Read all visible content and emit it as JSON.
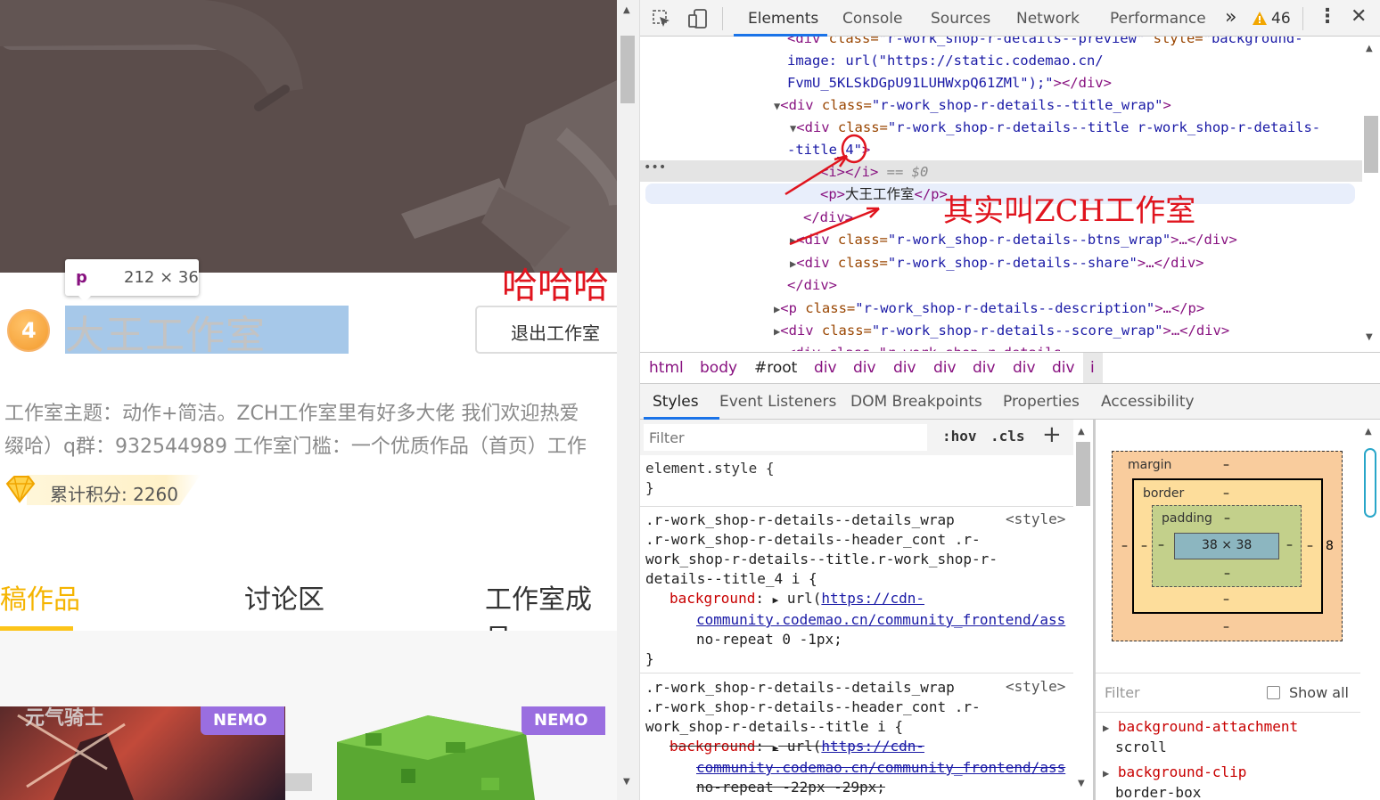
{
  "left": {
    "tooltip": {
      "tag": "p",
      "size": "212 × 36"
    },
    "level": "4",
    "studio_name": "大王工作室",
    "exit_button": "退出工作室",
    "red_annotation": "哈哈哈",
    "description_line1": "工作室主题：动作+简洁。ZCH工作室里有好多大佬 我们欢迎热爱",
    "description_line2": "缀哈）q群：932544989 工作室门槛：一个优质作品（首页）工作",
    "points": "累计积分: 2260",
    "tabs": [
      {
        "label": "投稿作品",
        "active": true
      },
      {
        "label": "讨论区",
        "active": false
      },
      {
        "label": "工作室成员",
        "active": false
      }
    ],
    "cards": [
      {
        "badge": "NEMO"
      },
      {
        "badge": "NEMO"
      }
    ]
  },
  "devtools": {
    "toolbar_tabs": [
      "Elements",
      "Console",
      "Sources",
      "Network",
      "Performance"
    ],
    "more": "»",
    "warnings": "46",
    "dom": {
      "l1_tag": "<div",
      "l1_attr": " class=",
      "l1_val": "\"r-work_shop-r-details--preview\"",
      "l1_attr2": " style=",
      "l1_val2": "\"background-",
      "l2": "image: url(\"https://static.codemao.cn/",
      "l3": "FvmU_5KLSkDGpU91LUHWxpQ61ZMl\");\"",
      "l3_end": "></div>",
      "l4_tag": "<div",
      "l4_attr": " class=",
      "l4_val": "\"r-work_shop-r-details--title_wrap\"",
      "l4_end": ">",
      "l5_tag": "<div",
      "l5_attr": " class=",
      "l5_val": "\"r-work_shop-r-details--title r-work_shop-r-details-",
      "l6_val": "-title_4\"",
      "l6_end": ">",
      "l7_tag": "<i></i>",
      "l7_eq": " == $0",
      "l8_tag_open": "<p>",
      "l8_text": "大王工作室",
      "l8_tag_close": "</p>",
      "l9": "</div>",
      "l10_tag": "<div",
      "l10_attr": " class=",
      "l10_val": "\"r-work_shop-r-details--btns_wrap\"",
      "l10_end": ">…</div>",
      "l11_tag": "<div",
      "l11_attr": " class=",
      "l11_val": "\"r-work_shop-r-details--share\"",
      "l11_end": ">…</div>",
      "l12": "</div>",
      "l13_tag": "<p",
      "l13_attr": " class=",
      "l13_val": "\"r-work_shop-r-details--description\"",
      "l13_end": ">…</p>",
      "l14_tag": "<div",
      "l14_attr": " class=",
      "l14_val": "\"r-work_shop-r-details--score_wrap\"",
      "l14_end": ">…</div>",
      "l15": "<div class=\"r-work_shop-r-details--..."
    },
    "annotation": "其实叫ZCH工作室",
    "breadcrumbs": [
      "html",
      "body",
      "#root",
      "div",
      "div",
      "div",
      "div",
      "div",
      "div",
      "div",
      "i"
    ],
    "subtabs": [
      "Styles",
      "Event Listeners",
      "DOM Breakpoints",
      "Properties",
      "Accessibility"
    ],
    "filter_placeholder": "Filter",
    "hov": ":hov",
    "cls": ".cls",
    "plus": "+",
    "styles": {
      "element_style": "element.style {",
      "close": "}",
      "rule1_sel1": ".r-work_shop-r-details--details_wrap",
      "rule1_src": "<style>",
      "rule1_sel2": ".r-work_shop-r-details--header_cont .r-",
      "rule1_sel3": "work_shop-r-details--title.r-work_shop-r-",
      "rule1_sel4": "details--title_4 i {",
      "rule1_prop": "background",
      "rule1_link1": "https://cdn-",
      "rule1_link2": "community.codemao.cn/community_frontend/ass",
      "rule1_rest": "no-repeat 0 -1px;",
      "rule2_sel1": ".r-work_shop-r-details--details_wrap",
      "rule2_src": "<style>",
      "rule2_sel2": ".r-work_shop-r-details--header_cont .r-",
      "rule2_sel3": "work_shop-r-details--title i {",
      "rule2_prop": "background",
      "rule2_link1": "https://cdn-",
      "rule2_link2": "community.codemao.cn/community_frontend/ass",
      "rule2_rest": "no-repeat -22px -29px;"
    },
    "boxmodel": {
      "margin": "margin",
      "border": "border",
      "padding": "padding",
      "content": "38 × 38",
      "dash": "–",
      "right_margin": "8"
    },
    "computed": {
      "filter": "Filter",
      "show_all": "Show all",
      "p1": "background-attachment",
      "v1": "scroll",
      "p2": "background-clip",
      "v2": "border-box"
    },
    "colors": {
      "tag": "#881280",
      "attr": "#994500",
      "value": "#1a1aa6",
      "accent": "#1a73e8",
      "annotation": "#e0141e"
    }
  }
}
